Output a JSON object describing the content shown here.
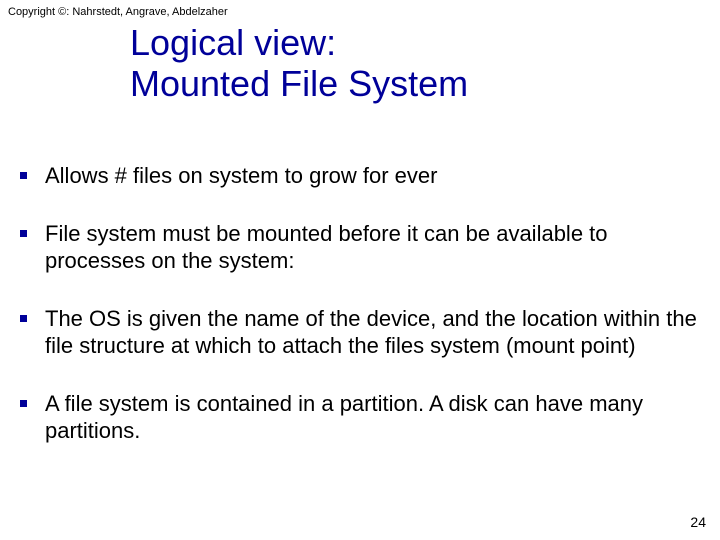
{
  "copyright": "Copyright ©: Nahrstedt, Angrave, Abdelzaher",
  "title_line1": "Logical view:",
  "title_line2": "Mounted File System",
  "bullets": [
    "Allows # files on system to grow for ever",
    "File system must be mounted before it can be available to processes on the system:",
    "The OS is given the name of the device, and the location within the file structure at which to attach the files system (mount point)",
    "A file system is contained in a partition. A disk can have many partitions."
  ],
  "page_number": "24"
}
